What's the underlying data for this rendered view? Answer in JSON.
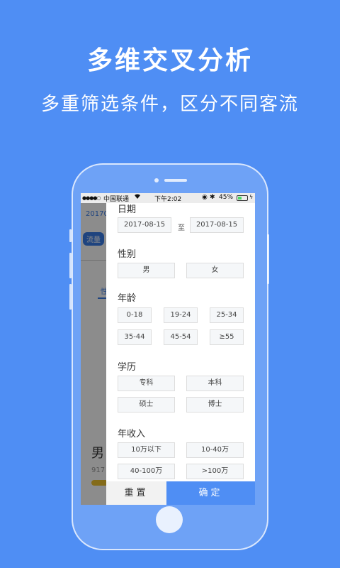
{
  "hero": {
    "title": "多维交叉分析",
    "subtitle": "多重筛选条件，区分不同客流"
  },
  "status_bar": {
    "signal": "●●●●○",
    "carrier": "中国联通",
    "wifi_icon": "wifi-icon",
    "time": "下午2:02",
    "battery_text": "45%",
    "battery_level": 0.45
  },
  "background_app": {
    "date_text": "20170",
    "tag_label": "流量",
    "tab_label": "性",
    "gender_text": "男",
    "value_text": "917"
  },
  "filter": {
    "date": {
      "label": "日期",
      "start": "2017-08-15",
      "separator": "至",
      "end": "2017-08-15"
    },
    "gender": {
      "label": "性别",
      "options": [
        "男",
        "女"
      ]
    },
    "age": {
      "label": "年龄",
      "options": [
        "0-18",
        "19-24",
        "25-34",
        "35-44",
        "45-54",
        "≥55"
      ]
    },
    "education": {
      "label": "学历",
      "options": [
        "专科",
        "本科",
        "硕士",
        "博士"
      ]
    },
    "income": {
      "label": "年收入",
      "options": [
        "10万以下",
        "10-40万",
        "40-100万",
        ">100万"
      ]
    },
    "reset_label": "重置",
    "confirm_label": "确定"
  },
  "colors": {
    "background": "#4f8ef4",
    "accent": "#4f8ef4",
    "chip_bg": "#f5f7f9"
  }
}
